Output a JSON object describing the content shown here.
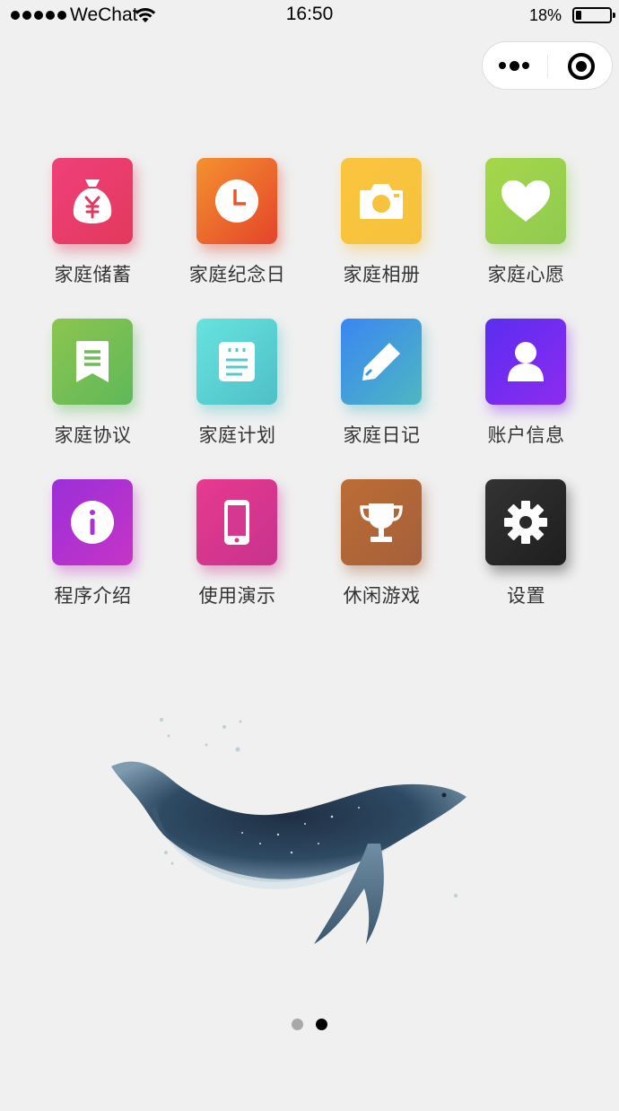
{
  "status_bar": {
    "carrier": "WeChat",
    "time": "16:50",
    "battery_percent_text": "18%",
    "battery_level": 0.18
  },
  "capsule": {
    "more_icon": "more-dots-icon",
    "close_icon": "target-circle-icon"
  },
  "menu": [
    {
      "label": "家庭储蓄",
      "icon": "money-bag-icon",
      "gradient": [
        "#f0407a",
        "#e2395c"
      ]
    },
    {
      "label": "家庭纪念日",
      "icon": "clock-icon",
      "gradient": [
        "#f4912f",
        "#e4442a"
      ]
    },
    {
      "label": "家庭相册",
      "icon": "camera-icon",
      "gradient": [
        "#fbc53e",
        "#f6c23c"
      ]
    },
    {
      "label": "家庭心愿",
      "icon": "heart-icon",
      "gradient": [
        "#a6d74a",
        "#8fca50"
      ]
    },
    {
      "label": "家庭协议",
      "icon": "bookmark-doc-icon",
      "gradient": [
        "#8cc54f",
        "#5fb85a"
      ]
    },
    {
      "label": "家庭计划",
      "icon": "notepad-icon",
      "gradient": [
        "#67e3e0",
        "#4fbfc6"
      ]
    },
    {
      "label": "家庭日记",
      "icon": "pencil-icon",
      "gradient": [
        "#3a86f2",
        "#4eb7c1"
      ]
    },
    {
      "label": "账户信息",
      "icon": "user-icon",
      "gradient": [
        "#5b2df0",
        "#8d2cf0"
      ]
    },
    {
      "label": "程序介绍",
      "icon": "info-icon",
      "gradient": [
        "#9b2fd8",
        "#c534c6"
      ]
    },
    {
      "label": "使用演示",
      "icon": "phone-icon",
      "gradient": [
        "#e63a8f",
        "#c7338d"
      ]
    },
    {
      "label": "休闲游戏",
      "icon": "trophy-icon",
      "gradient": [
        "#bd6d35",
        "#a45f3a"
      ]
    },
    {
      "label": "设置",
      "icon": "gear-icon",
      "gradient": [
        "#333333",
        "#1e1e1e"
      ]
    }
  ],
  "pager": {
    "pages": 2,
    "active": 1,
    "dot_color": "#a8a8a8",
    "active_color": "#000000"
  }
}
